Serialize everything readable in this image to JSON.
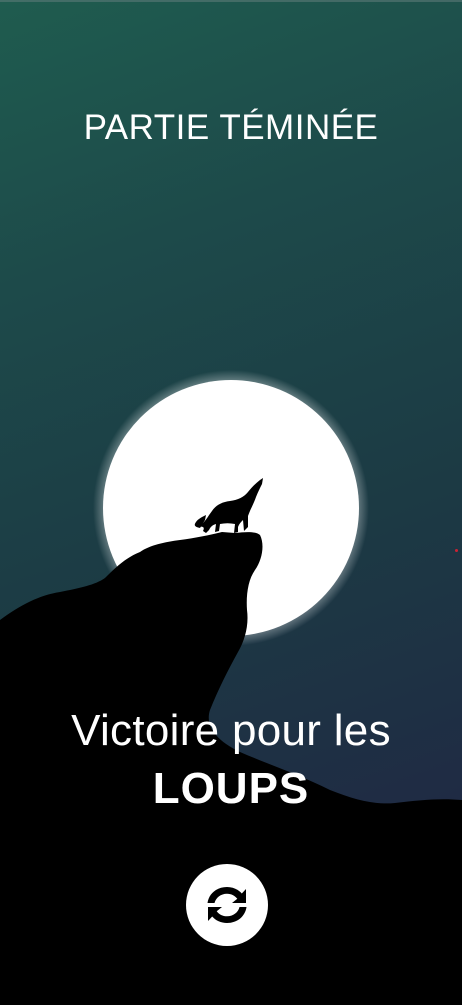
{
  "header": {
    "title": "PARTIE TÉMINÉE"
  },
  "scene": {
    "background_icon": "moon-wolf-silhouette-icon",
    "colors": {
      "sky_top": "#1f5c4f",
      "sky_bottom": "#22233f",
      "moon": "#ffffff",
      "silhouette": "#000000"
    }
  },
  "result": {
    "line1": "Victoire pour les",
    "winner": "LOUPS"
  },
  "actions": {
    "replay_icon": "refresh-icon"
  }
}
